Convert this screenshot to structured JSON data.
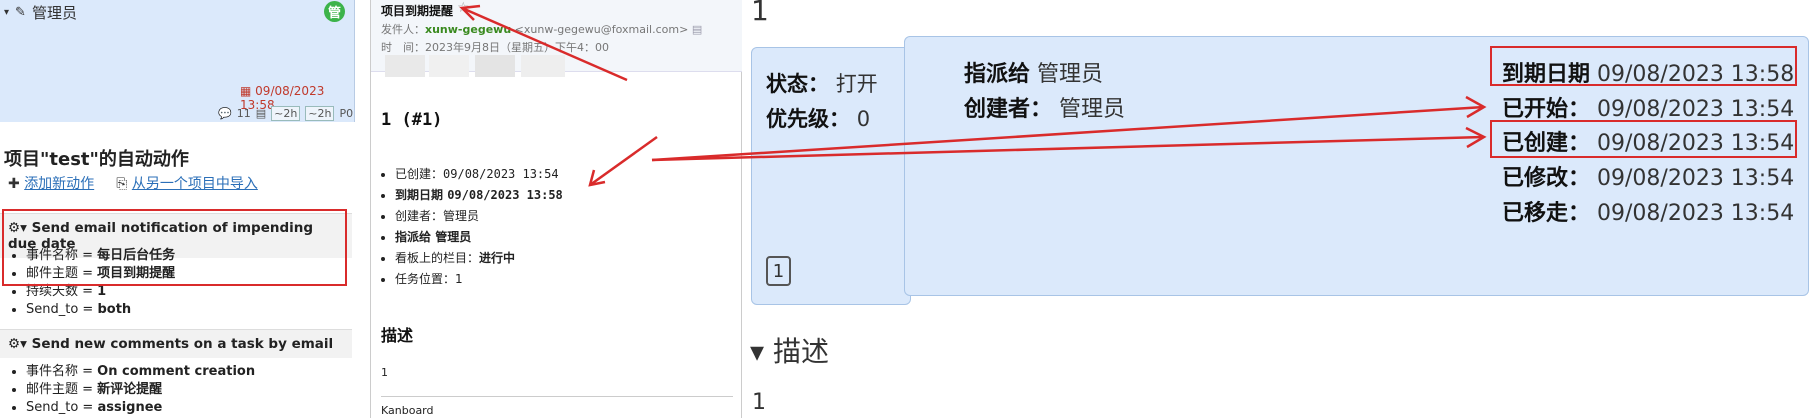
{
  "panel1": {
    "header_label": "管理员",
    "header_badge": "管",
    "due_date": "09/08/2023 13:58",
    "meta_count": "11",
    "meta_tag1": "~2h",
    "meta_tag2": "~2h",
    "meta_priority": "P0",
    "title": "项目\"test\"的自动动作",
    "link_add": "添加新动作",
    "link_import": "从另一个项目中导入",
    "sections": [
      {
        "title": "Send email notification of impending due date",
        "items": [
          {
            "k": "事件名称 = ",
            "v": "每日后台任务"
          },
          {
            "k": "邮件主题 = ",
            "v": "项目到期提醒"
          },
          {
            "k": "持续天数 = ",
            "v": "1"
          },
          {
            "k": "Send_to = ",
            "v": "both"
          }
        ]
      },
      {
        "title": "Send new comments on a task by email",
        "items": [
          {
            "k": "事件名称 = ",
            "v": "On comment creation"
          },
          {
            "k": "邮件主题 = ",
            "v": "新评论提醒"
          },
          {
            "k": "Send_to = ",
            "v": "assignee"
          }
        ]
      }
    ]
  },
  "panel2": {
    "subject": "项目到期提醒",
    "from_label": "发件人：",
    "from_name": "xunw-gegewu",
    "from_addr": "<xunw-gegewu@foxmail.com>",
    "time_label": "时　间：",
    "time_value": "2023年9月8日（星期五）下午4：00",
    "heading": "1 (#1)",
    "items": [
      {
        "k": "已创建：",
        "v": "09/08/2023 13:54"
      },
      {
        "k": "到期日期 ",
        "v": "09/08/2023 13:58"
      },
      {
        "k": "创建者：",
        "v": "管理员"
      },
      {
        "k": "指派给 ",
        "v": "管理员"
      },
      {
        "k": "看板上的栏目：",
        "v": "进行中"
      },
      {
        "k": "任务位置：",
        "v": "1"
      }
    ],
    "desc_title": "描述",
    "desc_body": "1",
    "footer": "Kanboard"
  },
  "panel3": {
    "number": "1",
    "status_label": "状态：",
    "status_value": "打开",
    "priority_label": "优先级：",
    "priority_value": "0",
    "position": "1",
    "desc_title": "描述",
    "desc_body": "1",
    "assignee_label": "指派给",
    "assignee_value": "管理员",
    "creator_label": "创建者：",
    "creator_value": "管理员",
    "dates": [
      {
        "label": "到期日期",
        "value": "09/08/2023 13:58"
      },
      {
        "label": "已开始：",
        "value": "09/08/2023 13:54"
      },
      {
        "label": "已创建：",
        "value": "09/08/2023 13:54"
      },
      {
        "label": "已修改：",
        "value": "09/08/2023 13:54"
      },
      {
        "label": "已移走：",
        "value": "09/08/2023 13:54"
      }
    ]
  },
  "colors": {
    "annotation_red": "#d92b2b",
    "card_blue": "#dbe9fb",
    "badge_green": "#3cb34a"
  }
}
